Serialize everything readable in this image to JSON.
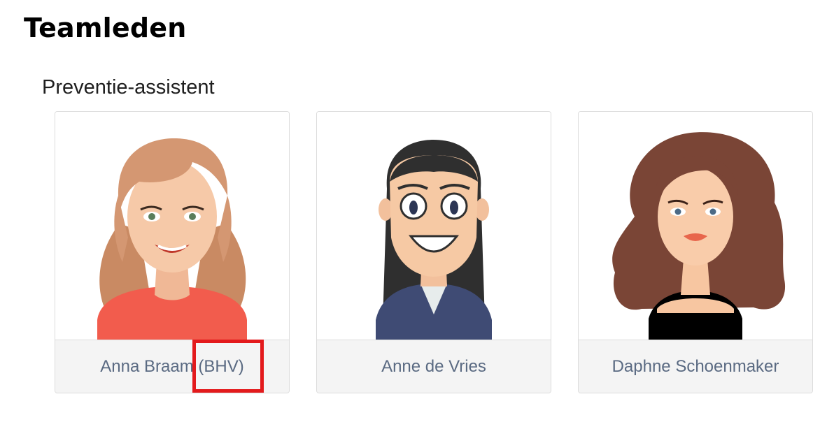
{
  "page": {
    "title": "Teamleden"
  },
  "section": {
    "title": "Preventie-assistent"
  },
  "members": [
    {
      "name": "Anna Braam (BHV)",
      "avatar": "avatar-blonde-woman"
    },
    {
      "name": "Anne de Vries",
      "avatar": "avatar-dark-haired-woman"
    },
    {
      "name": "Daphne Schoenmaker",
      "avatar": "avatar-curly-haired-woman"
    }
  ],
  "colors": {
    "highlight": "#e31a1c",
    "name_text": "#5a6a82",
    "footer_bg": "#f4f4f4"
  }
}
